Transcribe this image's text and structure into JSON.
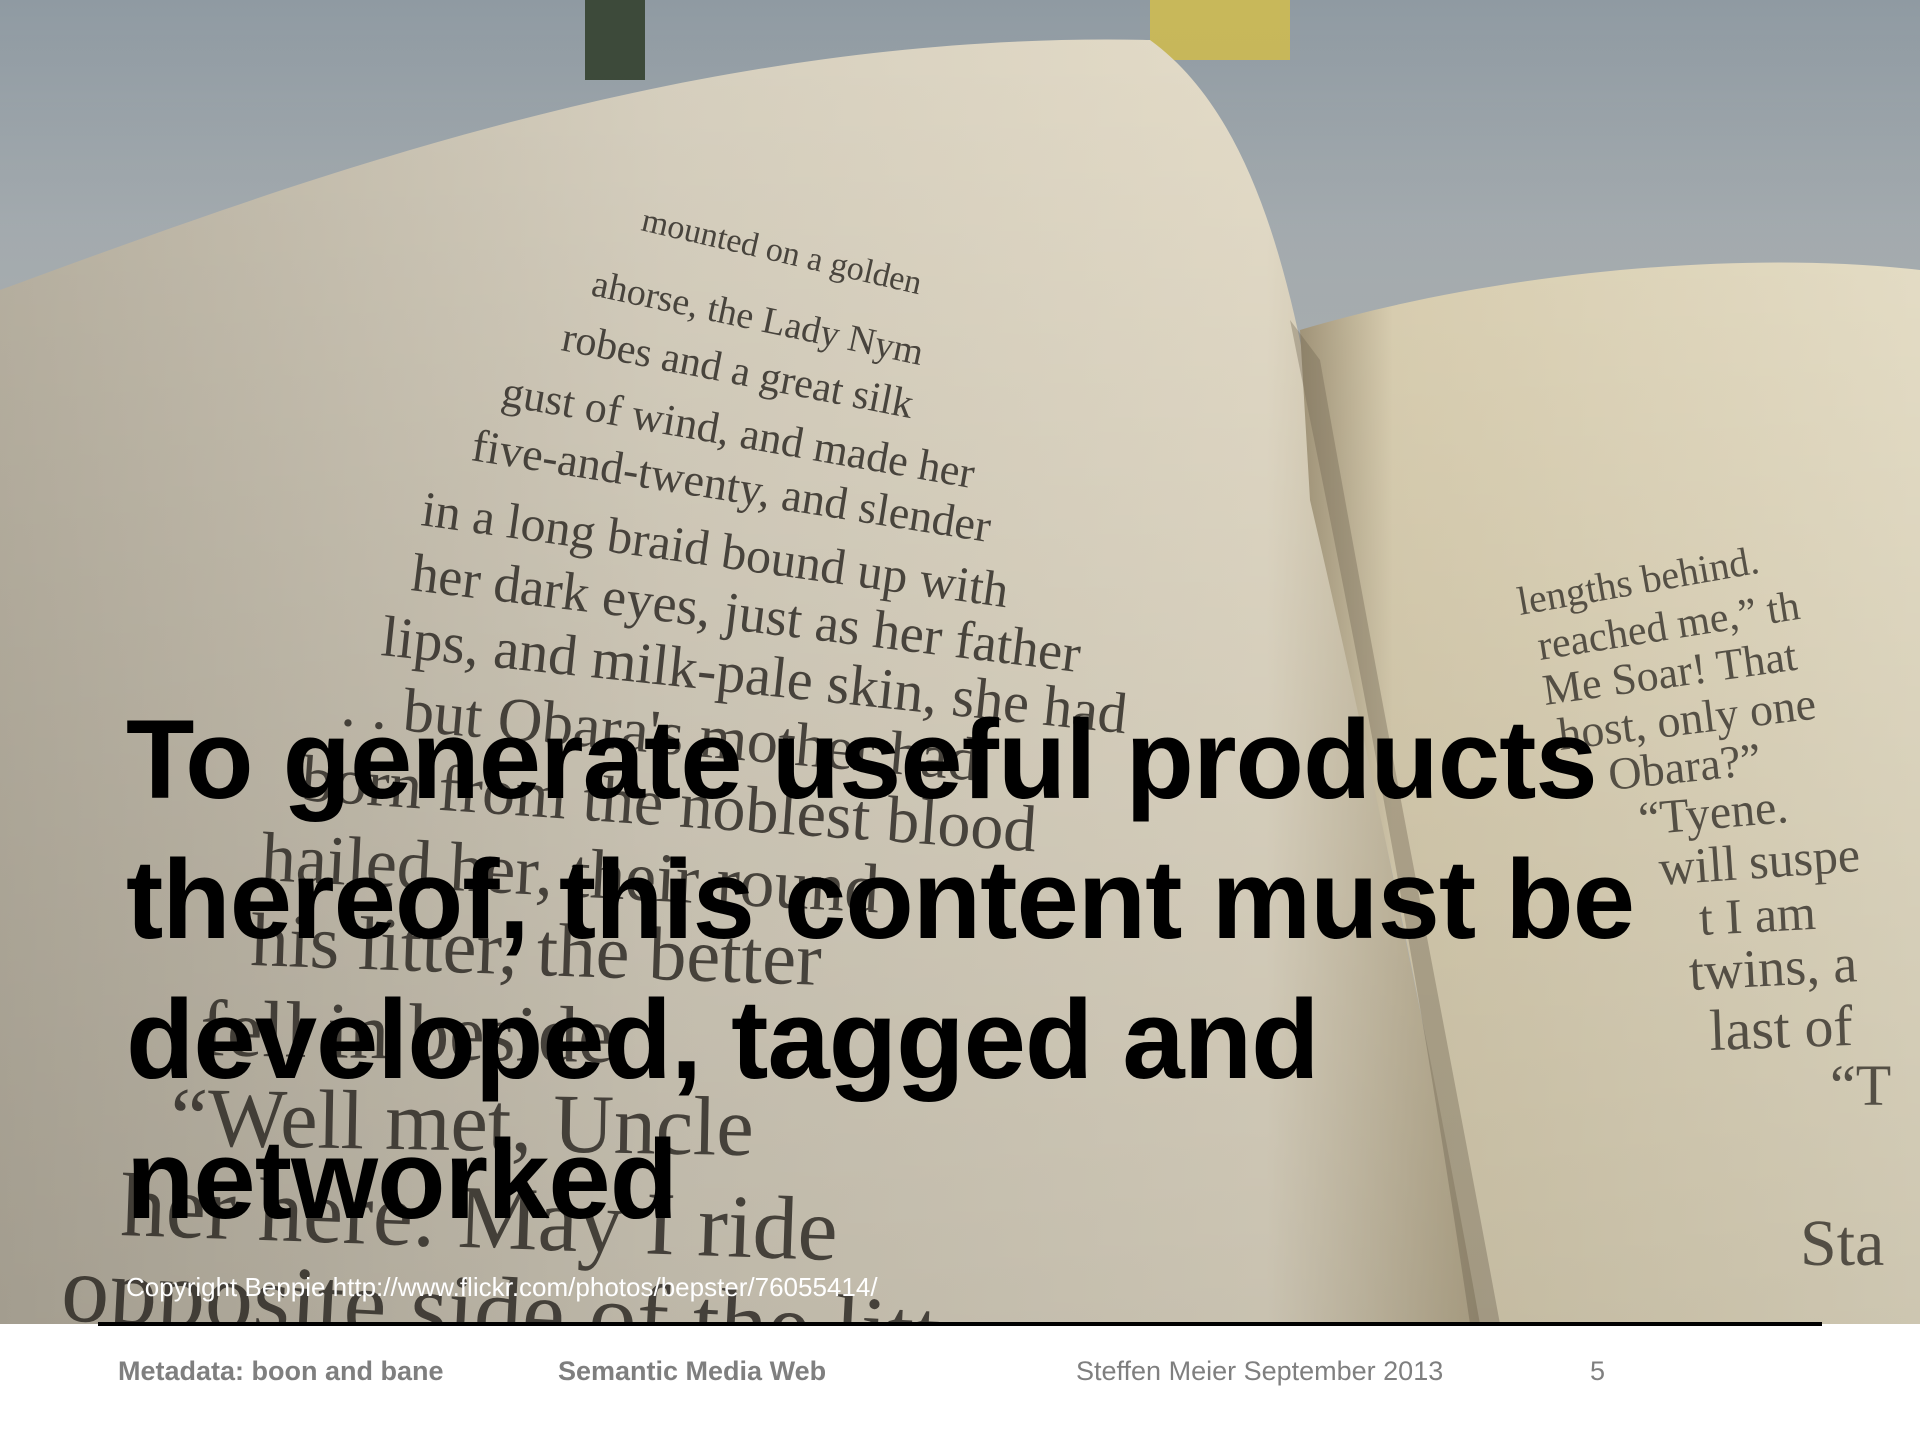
{
  "slide": {
    "headline_lines": [
      "To generate useful products",
      "thereof, this content must be",
      "developed, tagged and",
      "networked"
    ],
    "image_credit": "Copyright Beppie http://www.flickr.com/photos/bepster/76055414/",
    "book_text_left": [
      "mounted on a golden",
      "ahorse, the Lady Nym",
      "robes and a great silk",
      "gust of wind, and made her",
      "five-and-twenty, and slender",
      "in a long braid bound up with",
      "her dark eyes, just as her father",
      "lips, and milk-pale skin, she had",
      ". . but Obara's mother had",
      "born from the noblest blood",
      "hailed her, their round",
      "his litter, the better",
      "fell in beside",
      "“Well met, Uncle",
      "her here. May I ride",
      "opposite side of the litter"
    ],
    "book_text_right": [
      "lengths behind.",
      "reached me,” th",
      "Me Soar! That",
      "host, only one",
      "Obara?”",
      "“Tyene.",
      "will suspe",
      "t I am",
      "twins, a",
      "last of",
      "“T",
      "Sta"
    ]
  },
  "footer": {
    "presentation_title": "Metadata: boon and bane",
    "course": "Semantic Media Web",
    "author_date": "Steffen Meier  September 2013",
    "page_number": "5"
  },
  "colors": {
    "text": "#000000",
    "credit": "#ffffff",
    "footer_text": "#7f7f7f",
    "rule": "#000000"
  }
}
